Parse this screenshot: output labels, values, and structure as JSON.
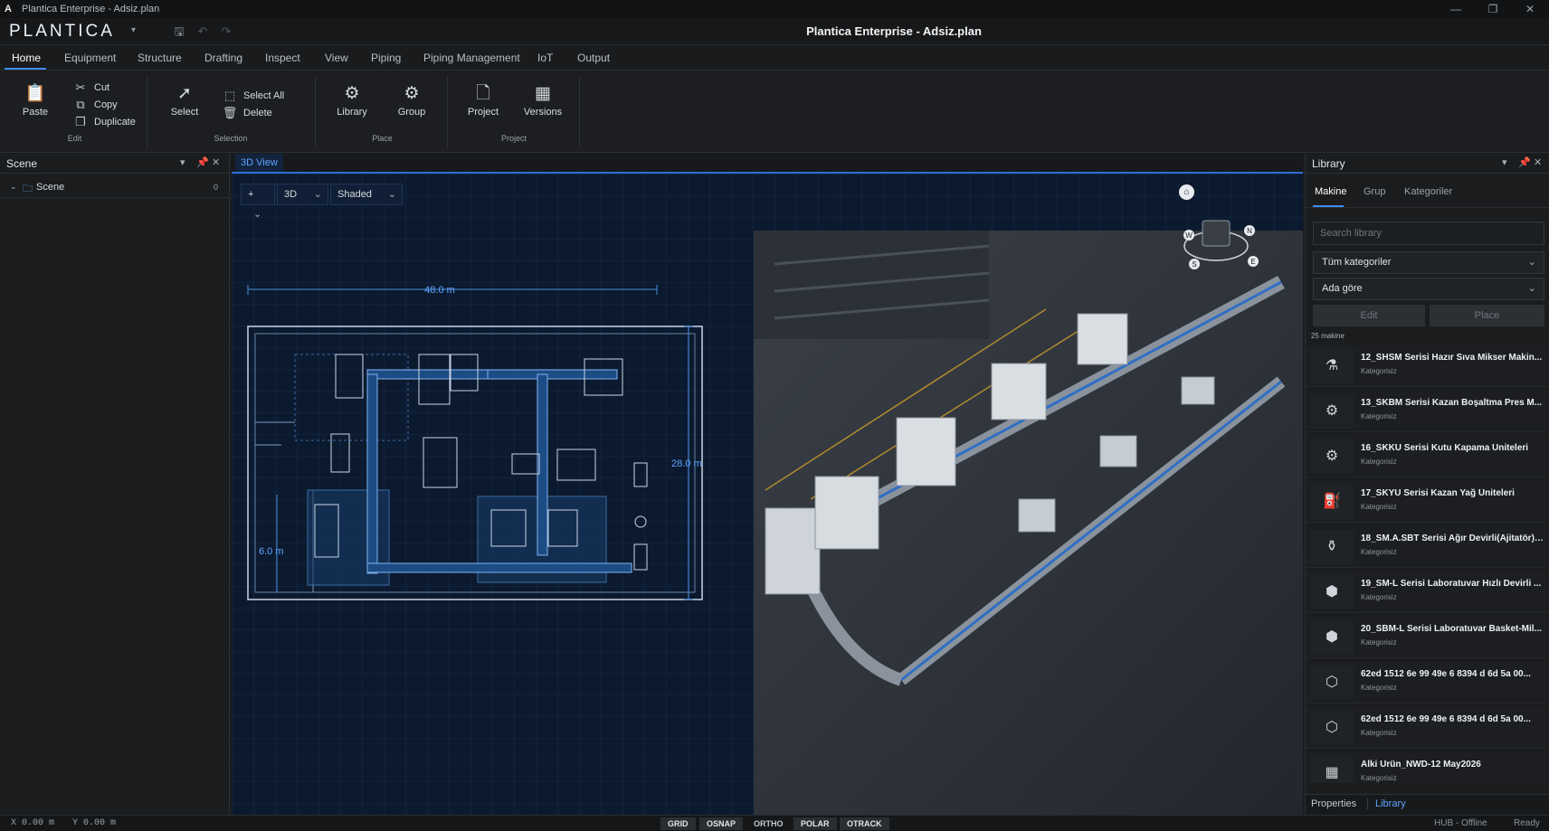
{
  "window": {
    "app_icon": "A",
    "title": "Plantica Enterprise - Adsiz.plan",
    "controls": [
      "—",
      "❐",
      "✕"
    ]
  },
  "appbar": {
    "logo": "PLANTICA",
    "document_title": "Plantica Enterprise - Adsiz.plan",
    "quick_access": [
      "save-icon",
      "undo-icon",
      "redo-icon"
    ]
  },
  "menu": {
    "items": [
      "Home",
      "Equipment",
      "Structure",
      "Drafting",
      "Inspect",
      "View",
      "Piping",
      "Piping Management",
      "IoT",
      "Output"
    ],
    "active": "Home"
  },
  "ribbon": {
    "edit": {
      "paste": "Paste",
      "cut": "Cut",
      "copy": "Copy",
      "duplicate": "Duplicate",
      "group_label": "Edit"
    },
    "selection": {
      "select": "Select",
      "select_all": "Select All",
      "delete": "Delete",
      "group_label": "Selection"
    },
    "place": {
      "library": "Library",
      "group": "Group",
      "group_label": "Place"
    },
    "project": {
      "project": "Project",
      "versions": "Versions",
      "group_label": "Project"
    }
  },
  "scene_panel": {
    "title": "Scene",
    "tree": [
      {
        "label": "Scene",
        "count": "0"
      }
    ]
  },
  "viewport": {
    "tab": "3D View",
    "toolbar": {
      "add": "+",
      "mode": "3D",
      "shading": "Shaded"
    },
    "dimensions": {
      "width": "48.0 m",
      "height": "28.0 m",
      "sub": "6.0 m"
    },
    "compass": [
      "W",
      "N",
      "S",
      "E"
    ]
  },
  "library": {
    "title": "Library",
    "tabs": [
      "Makine",
      "Grup",
      "Kategoriler"
    ],
    "active_tab": "Makine",
    "search_placeholder": "Search library",
    "category_select": "Tüm kategoriler",
    "sort_select": "Ada göre",
    "edit_button": "Edit",
    "place_button": "Place",
    "count": "25 makine",
    "items": [
      {
        "name": "12_SHSM Serisi Hazır Sıva Mikser Makin...",
        "category": "Kategorisiz"
      },
      {
        "name": "13_SKBM Serisi Kazan Boşaltma Pres M...",
        "category": "Kategorisiz"
      },
      {
        "name": "16_SKKU Serisi Kutu Kapama Üniteleri",
        "category": "Kategorisiz"
      },
      {
        "name": "17_SKYU Serisi Kazan Yağ Üniteleri",
        "category": "Kategorisiz"
      },
      {
        "name": "18_SM.A.SBT Serisi Ağır Devirli(Ajitatör) ...",
        "category": "Kategorisiz"
      },
      {
        "name": "19_SM-L Serisi Laboratuvar Hızlı Devirli ...",
        "category": "Kategorisiz"
      },
      {
        "name": "20_SBM-L Serisi Laboratuvar Basket-Mil...",
        "category": "Kategorisiz"
      },
      {
        "name": "62ed 1512 6e 99 49e 6 8394 d 6d 5a 00...",
        "category": "Kategorisiz"
      },
      {
        "name": "62ed 1512 6e 99 49e 6 8394 d 6d 5a 00...",
        "category": "Kategorisiz"
      },
      {
        "name": "Alki Urün_NWD-12 May2026",
        "category": "Kategorisiz"
      }
    ],
    "bottom_tabs": [
      "Properties",
      "Library"
    ]
  },
  "statusbar": {
    "x": "X 0.00 m",
    "y": "Y 0.00 m",
    "toggles": [
      {
        "label": "GRID",
        "on": true
      },
      {
        "label": "OSNAP",
        "on": true
      },
      {
        "label": "ORTHO",
        "on": false
      },
      {
        "label": "POLAR",
        "on": true
      },
      {
        "label": "OTRACK",
        "on": true
      }
    ],
    "hub": "HUB - Offline",
    "state": "Ready"
  },
  "colors": {
    "accent": "#3f8cf1",
    "viewport_bg": "#0c1a2f",
    "blueprint_line": "#4a90e0"
  }
}
